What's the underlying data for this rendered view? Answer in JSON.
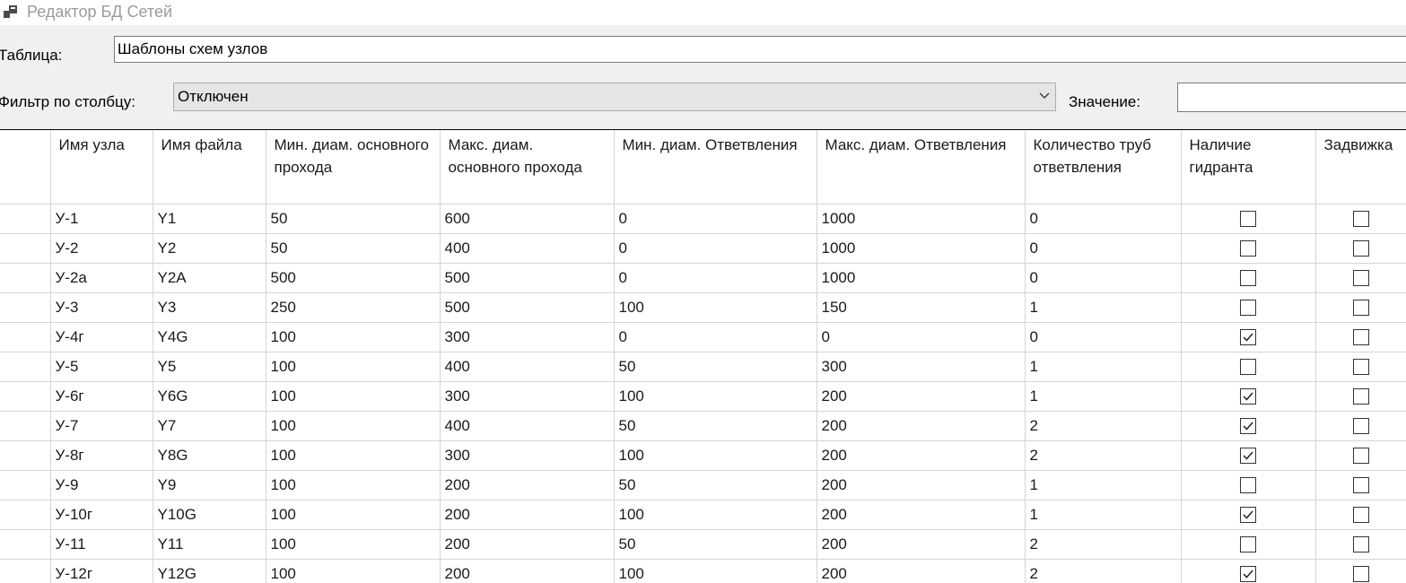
{
  "window": {
    "title": "Редактор БД Сетей",
    "icon": "app-window-icon"
  },
  "form": {
    "table_label": "Таблица:",
    "table_value": "Шаблоны схем узлов",
    "filter_label": "Фильтр по столбцу:",
    "filter_selected": "Отключен",
    "value_label": "Значение:",
    "value_input": ""
  },
  "grid": {
    "columns": [
      "Имя узла",
      "Имя файла",
      "Мин. диам. основного прохода",
      "Макс. диам. основного прохода",
      "Мин. диам. Ответвления",
      "Макс. диам. Ответвления",
      "Количество труб ответвления",
      "Наличие гидранта",
      "Задвижка"
    ],
    "rows": [
      {
        "name": "У-1",
        "file": "Y1",
        "min_main": "50",
        "max_main": "600",
        "min_branch": "0",
        "max_branch": "1000",
        "pipes": "0",
        "hydrant": false,
        "valve": false
      },
      {
        "name": "У-2",
        "file": "Y2",
        "min_main": "50",
        "max_main": "400",
        "min_branch": "0",
        "max_branch": "1000",
        "pipes": "0",
        "hydrant": false,
        "valve": false
      },
      {
        "name": "У-2а",
        "file": "Y2A",
        "min_main": "500",
        "max_main": "500",
        "min_branch": "0",
        "max_branch": "1000",
        "pipes": "0",
        "hydrant": false,
        "valve": false
      },
      {
        "name": "У-3",
        "file": "Y3",
        "min_main": "250",
        "max_main": "500",
        "min_branch": "100",
        "max_branch": "150",
        "pipes": "1",
        "hydrant": false,
        "valve": false
      },
      {
        "name": "У-4г",
        "file": "Y4G",
        "min_main": "100",
        "max_main": "300",
        "min_branch": "0",
        "max_branch": "0",
        "pipes": "0",
        "hydrant": true,
        "valve": false
      },
      {
        "name": "У-5",
        "file": "Y5",
        "min_main": "100",
        "max_main": "400",
        "min_branch": "50",
        "max_branch": "300",
        "pipes": "1",
        "hydrant": false,
        "valve": false
      },
      {
        "name": "У-6г",
        "file": "Y6G",
        "min_main": "100",
        "max_main": "300",
        "min_branch": "100",
        "max_branch": "200",
        "pipes": "1",
        "hydrant": true,
        "valve": false
      },
      {
        "name": "У-7",
        "file": "Y7",
        "min_main": "100",
        "max_main": "400",
        "min_branch": "50",
        "max_branch": "200",
        "pipes": "2",
        "hydrant": true,
        "valve": false
      },
      {
        "name": "У-8г",
        "file": "Y8G",
        "min_main": "100",
        "max_main": "300",
        "min_branch": "100",
        "max_branch": "200",
        "pipes": "2",
        "hydrant": true,
        "valve": false
      },
      {
        "name": "У-9",
        "file": "Y9",
        "min_main": "100",
        "max_main": "200",
        "min_branch": "50",
        "max_branch": "200",
        "pipes": "1",
        "hydrant": false,
        "valve": false
      },
      {
        "name": "У-10г",
        "file": "Y10G",
        "min_main": "100",
        "max_main": "200",
        "min_branch": "100",
        "max_branch": "200",
        "pipes": "1",
        "hydrant": true,
        "valve": false
      },
      {
        "name": "У-11",
        "file": "Y11",
        "min_main": "100",
        "max_main": "200",
        "min_branch": "50",
        "max_branch": "200",
        "pipes": "2",
        "hydrant": false,
        "valve": false
      },
      {
        "name": "У-12г",
        "file": "Y12G",
        "min_main": "100",
        "max_main": "200",
        "min_branch": "100",
        "max_branch": "200",
        "pipes": "2",
        "hydrant": true,
        "valve": false
      }
    ]
  }
}
